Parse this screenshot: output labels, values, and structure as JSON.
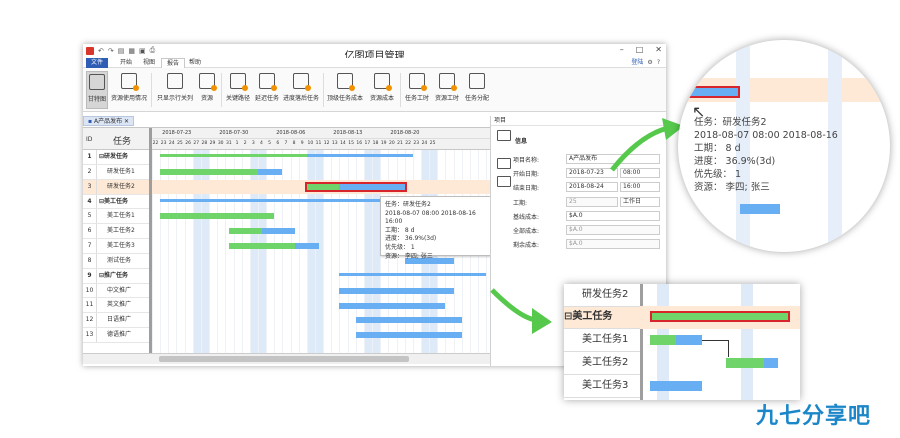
{
  "window": {
    "title": "亿图项目管理",
    "menus": [
      "文件",
      "开始",
      "视图",
      "报告",
      "帮助"
    ],
    "login": "登陆"
  },
  "ribbon": {
    "buttons": [
      "甘特图",
      "资源使用情况",
      "只显示行关列",
      "资源",
      "关键路径",
      "延迟任务",
      "进度落后任务",
      "顶级任务成本",
      "资源成本",
      "任务工时",
      "资源工时",
      "任务分配"
    ]
  },
  "doc_tab": "A产品发布",
  "grid": {
    "id_header": "ID",
    "task_header": "任务",
    "rows": [
      {
        "id": "1",
        "name": "研发任务",
        "bold": true,
        "collapse": "⊟"
      },
      {
        "id": "2",
        "name": "研发任务1"
      },
      {
        "id": "3",
        "name": "研发任务2"
      },
      {
        "id": "4",
        "name": "美工任务",
        "bold": true,
        "collapse": "⊟"
      },
      {
        "id": "5",
        "name": "美工任务1"
      },
      {
        "id": "6",
        "name": "美工任务2"
      },
      {
        "id": "7",
        "name": "美工任务3"
      },
      {
        "id": "8",
        "name": "测试任务"
      },
      {
        "id": "9",
        "name": "推广任务",
        "bold": true,
        "collapse": "⊟"
      },
      {
        "id": "10",
        "name": "中文推广"
      },
      {
        "id": "11",
        "name": "英文推广"
      },
      {
        "id": "12",
        "name": "日语推广"
      },
      {
        "id": "13",
        "name": "德语推广"
      }
    ]
  },
  "timeline": {
    "weeks": [
      "2018-07-23",
      "2018-07-30",
      "2018-08-06",
      "2018-08-13",
      "2018-08-20"
    ],
    "days": [
      "22",
      "23",
      "24",
      "25",
      "26",
      "27",
      "28",
      "29",
      "30",
      "31",
      "1",
      "2",
      "3",
      "4",
      "5",
      "6",
      "7",
      "8",
      "9",
      "10",
      "11",
      "12",
      "13",
      "14",
      "15",
      "16",
      "17",
      "18",
      "19",
      "20",
      "21",
      "22",
      "23",
      "24",
      "25"
    ]
  },
  "tooltip": {
    "lines": [
      "任务：研发任务2",
      "2018-08-07 08:00 2018-08-16 16:00",
      "工期：  8 d",
      "进度：  36.9%(3d)",
      "优先级：  1",
      "资源：  李四; 张三"
    ]
  },
  "panel": {
    "header": "项目",
    "section": "信息",
    "fields": [
      {
        "label": "项目名称:",
        "value": "A产品发布"
      },
      {
        "label": "开始日期:",
        "value": "2018-07-23",
        "time": "08:00"
      },
      {
        "label": "结束日期:",
        "value": "2018-08-24",
        "time": "16:00"
      },
      {
        "label": "工期:",
        "value": "25",
        "unit": "工作日"
      },
      {
        "label": "基线成本:",
        "value": "$A.0"
      },
      {
        "label": "全部成本:",
        "value": "$A.0"
      },
      {
        "label": "剩余成本:",
        "value": "$A.0"
      }
    ]
  },
  "zoom_tooltip": [
    "任务：研发任务2",
    "2018-08-07 08:00 2018-08-16",
    "工期：  8 d",
    "进度：  36.9%(3d)",
    "优先级：  1",
    "资源：  李四; 张三"
  ],
  "zoom_rows": [
    "研发任务2",
    "美工任务",
    "美工任务1",
    "美工任务2",
    "美工任务3"
  ],
  "brand": "九七分享吧",
  "colors": {
    "accent": "#2d5db5",
    "green_bar": "#6fd46a",
    "blue_bar": "#68aef3",
    "select_red": "#d8242b",
    "arrow_green": "#56c94c"
  }
}
